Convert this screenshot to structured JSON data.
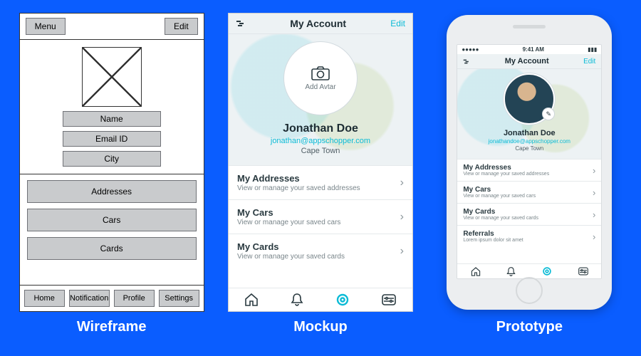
{
  "captions": {
    "wireframe": "Wireframe",
    "mockup": "Mockup",
    "prototype": "Prototype"
  },
  "colors": {
    "bg": "#0a5dff",
    "accent": "#0bbbd6",
    "gray_btn": "#c9cbcd"
  },
  "wireframe": {
    "menu_label": "Menu",
    "edit_label": "Edit",
    "fields": {
      "name": "Name",
      "email": "Email ID",
      "city": "City"
    },
    "rows": {
      "addresses": "Addresses",
      "cars": "Cars",
      "cards": "Cards"
    },
    "tabs": {
      "home": "Home",
      "notification": "Notification",
      "profile": "Profile",
      "settings": "Settings"
    }
  },
  "mockup": {
    "header_title": "My Account",
    "edit_label": "Edit",
    "avatar_add_label": "Add Avtar",
    "user_name": "Jonathan Doe",
    "user_email": "jonathan@appschopper.com",
    "user_city": "Cape Town",
    "items": [
      {
        "title": "My Addresses",
        "subtitle": "View or manage your saved addresses"
      },
      {
        "title": "My Cars",
        "subtitle": "View or manage your saved cars"
      },
      {
        "title": "My Cards",
        "subtitle": "View or manage your saved cards"
      }
    ]
  },
  "prototype": {
    "status": {
      "left": "●●●●●",
      "time": "9:41 AM",
      "right": "▮▮▮"
    },
    "header_title": "My Account",
    "edit_label": "Edit",
    "user_name": "Jonathan Doe",
    "user_email": "jonathandoe@appschopper.com",
    "user_city": "Cape Town",
    "items": [
      {
        "title": "My Addresses",
        "subtitle": "View or manage your saved addresses"
      },
      {
        "title": "My Cars",
        "subtitle": "View or manage your saved cars"
      },
      {
        "title": "My Cards",
        "subtitle": "View or manage your saved cards"
      },
      {
        "title": "Referrals",
        "subtitle": "Lorem ipsum dolor sit amet"
      }
    ]
  }
}
